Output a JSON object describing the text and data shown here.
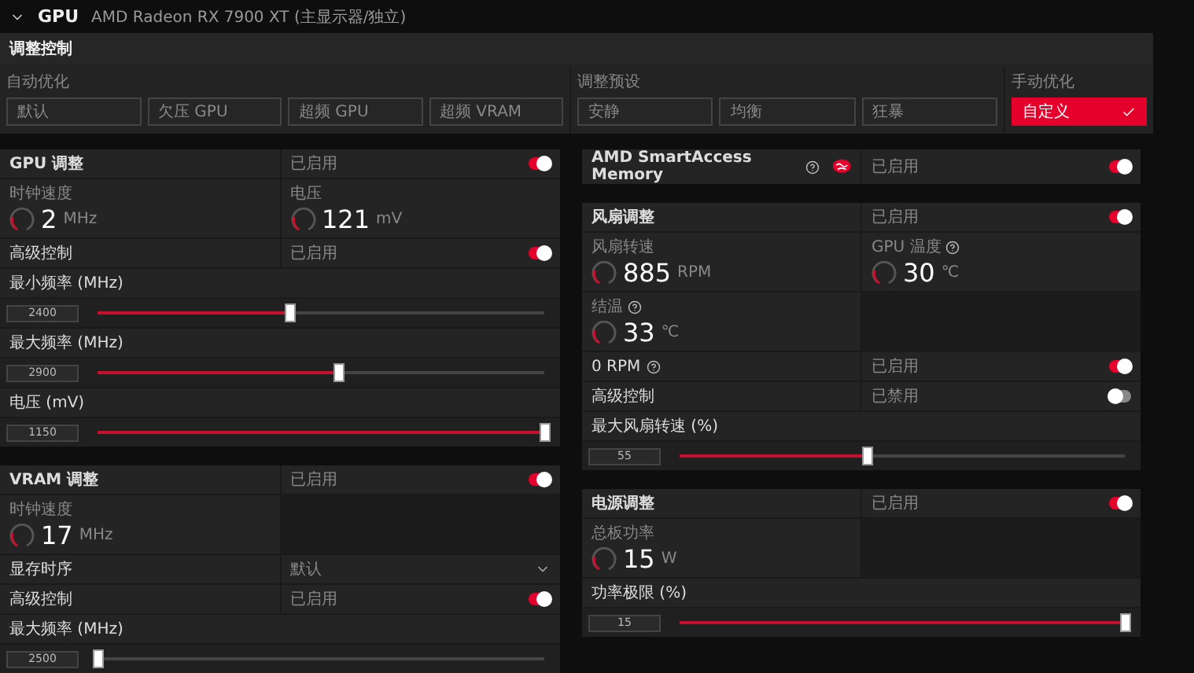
{
  "header": {
    "title": "GPU",
    "device": "AMD Radeon RX 7900 XT (主显示器/独立)"
  },
  "tuning_control": {
    "title": "调整控制",
    "groups": [
      {
        "label": "自动优化",
        "options": [
          {
            "label": "默认",
            "selected": false
          },
          {
            "label": "欠压 GPU",
            "selected": false
          },
          {
            "label": "超频 GPU",
            "selected": false
          },
          {
            "label": "超频 VRAM",
            "selected": false
          }
        ]
      },
      {
        "label": "调整预设",
        "options": [
          {
            "label": "安静",
            "selected": false
          },
          {
            "label": "均衡",
            "selected": false
          },
          {
            "label": "狂暴",
            "selected": false
          }
        ]
      },
      {
        "label": "手动优化",
        "options": [
          {
            "label": "自定义",
            "selected": true
          }
        ]
      }
    ]
  },
  "left_column": [
    {
      "rows": [
        {
          "kind": "header",
          "label": "GPU 调整",
          "status": "已启用",
          "on": true
        },
        {
          "kind": "metrics",
          "items": [
            {
              "label": "时钟速度",
              "value": "2",
              "unit": "MHz"
            },
            {
              "label": "电压",
              "value": "121",
              "unit": "mV"
            }
          ]
        },
        {
          "kind": "toggle",
          "label": "高级控制",
          "status": "已启用",
          "on": true
        },
        {
          "kind": "slider",
          "label": "最小频率 (MHz)",
          "value": "2400",
          "level": 0.43
        },
        {
          "kind": "slider",
          "label": "最大频率 (MHz)",
          "value": "2900",
          "level": 0.54
        },
        {
          "kind": "slider",
          "label": "电压 (mV)",
          "value": "1150",
          "level": 1.0
        }
      ]
    },
    {
      "rows": [
        {
          "kind": "header",
          "label": "VRAM 调整",
          "status": "已启用",
          "on": true
        },
        {
          "kind": "metrics",
          "items": [
            {
              "label": "时钟速度",
              "value": "17",
              "unit": "MHz"
            }
          ]
        },
        {
          "kind": "dropdown",
          "label": "显存时序",
          "value": "默认"
        },
        {
          "kind": "toggle",
          "label": "高级控制",
          "status": "已启用",
          "on": true
        },
        {
          "kind": "slider",
          "label": "最大频率 (MHz)",
          "value": "2500",
          "level": 0.0
        }
      ]
    }
  ],
  "right_column": [
    {
      "rows": [
        {
          "kind": "feature",
          "label": "AMD SmartAccess Memory",
          "help": true,
          "status": "已启用",
          "on": true
        }
      ]
    },
    {
      "rows": [
        {
          "kind": "header",
          "label": "风扇调整",
          "status": "已启用",
          "on": true
        },
        {
          "kind": "metrics",
          "items": [
            {
              "label": "风扇转速",
              "value": "885",
              "unit": "RPM"
            },
            {
              "label": "GPU 温度",
              "value": "30",
              "unit": "℃",
              "help": true
            },
            {
              "label": "结温",
              "value": "33",
              "unit": "℃",
              "help": true
            }
          ]
        },
        {
          "kind": "toggle",
          "label": "0 RPM",
          "help": true,
          "status": "已启用",
          "on": true
        },
        {
          "kind": "toggle",
          "label": "高级控制",
          "status": "已禁用",
          "on": false
        },
        {
          "kind": "slider",
          "label": "最大风扇转速 (%)",
          "value": "55",
          "level": 0.42
        }
      ]
    },
    {
      "rows": [
        {
          "kind": "header",
          "label": "电源调整",
          "status": "已启用",
          "on": true
        },
        {
          "kind": "metrics",
          "items": [
            {
              "label": "总板功率",
              "value": "15",
              "unit": "W"
            }
          ]
        },
        {
          "kind": "slider",
          "label": "功率极限 (%)",
          "value": "15",
          "level": 1.0
        }
      ]
    }
  ]
}
